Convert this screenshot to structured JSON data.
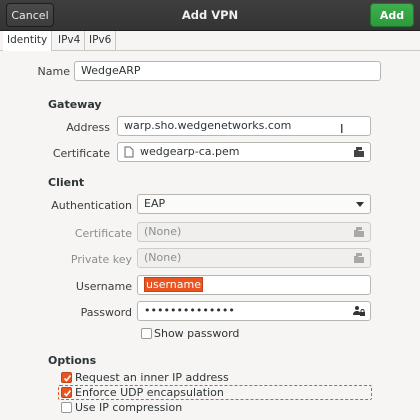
{
  "header": {
    "title": "Add VPN",
    "cancel_label": "Cancel",
    "add_label": "Add"
  },
  "tabs": [
    {
      "label": "Identity"
    },
    {
      "label": "IPv4"
    },
    {
      "label": "IPv6"
    }
  ],
  "name": {
    "label": "Name",
    "value": "WedgeARP"
  },
  "gateway": {
    "section": "Gateway",
    "address_label": "Address",
    "address_value": "warp.sho.wedgenetworks.com",
    "certificate_label": "Certificate",
    "certificate_value": "wedgearp-ca.pem"
  },
  "client": {
    "section": "Client",
    "authentication_label": "Authentication",
    "authentication_value": "EAP",
    "certificate_label": "Certificate",
    "certificate_value": "(None)",
    "private_key_label": "Private key",
    "private_key_value": "(None)",
    "username_label": "Username",
    "username_value": "username",
    "password_label": "Password",
    "password_value": "••••••••••••••",
    "show_password_label": "Show password"
  },
  "options": {
    "section": "Options",
    "inner_ip_label": "Request an inner IP address",
    "inner_ip_checked": true,
    "udp_label": "Enforce UDP encapsulation",
    "udp_checked": true,
    "compression_label": "Use IP compression",
    "compression_checked": false
  },
  "colors": {
    "accent": "#e95420",
    "add_button": "#38a845",
    "headerbar": "#393939"
  }
}
